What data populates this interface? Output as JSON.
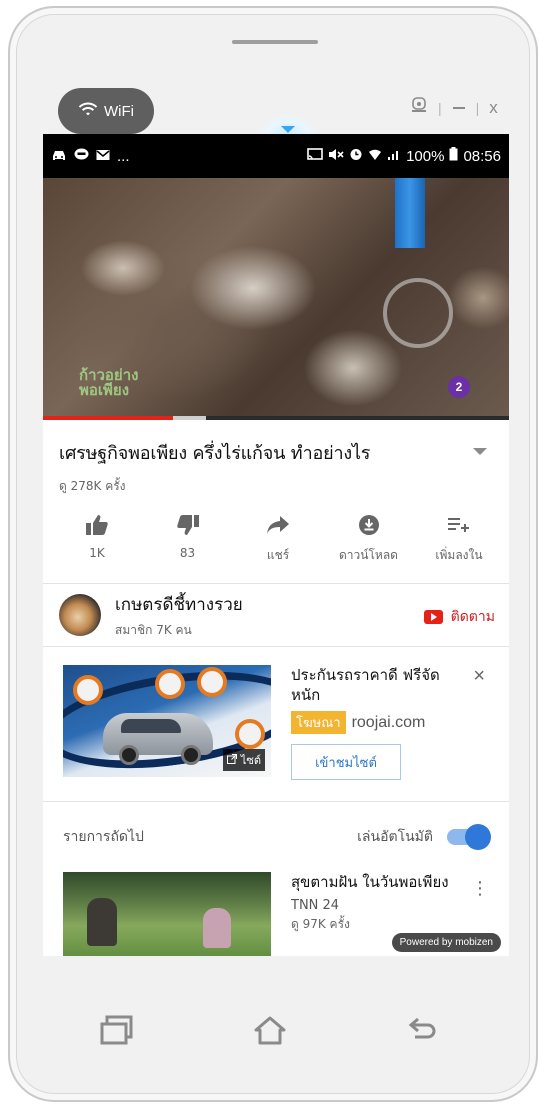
{
  "wrapper": {
    "wifi_label": "WiFi",
    "controls": {
      "separator": "|",
      "close": "x"
    }
  },
  "statusbar": {
    "left_more": "...",
    "battery": "100%",
    "time": "08:56"
  },
  "video": {
    "watermark_line1": "ก้าวอย่าง",
    "watermark_line2": "พอเพียง",
    "channel_logo": "2"
  },
  "info": {
    "title": "เศรษฐกิจพอเพียง ครึ่งไร่แก้จน ทำอย่างไร",
    "views": "ดู 278K ครั้ง"
  },
  "actions": [
    {
      "icon": "thumbs-up-icon",
      "label": "1K"
    },
    {
      "icon": "thumbs-down-icon",
      "label": "83"
    },
    {
      "icon": "share-icon",
      "label": "แชร์"
    },
    {
      "icon": "download-icon",
      "label": "ดาวน์โหลด"
    },
    {
      "icon": "add-to-playlist-icon",
      "label": "เพิ่มลงใน"
    }
  ],
  "channel": {
    "name": "เกษตรดีชี้ทางรวย",
    "subscribers": "สมาชิก 7K คน",
    "subscribe_label": "ติดตาม"
  },
  "ad": {
    "title": "ประกันรถราคาดี ฟรีจัดหนัก",
    "badge": "โฆษณา",
    "domain": "roojai.com",
    "cta": "เข้าชมไซต์",
    "thumb_site_label": "ไซต์",
    "close": "×"
  },
  "up_next": {
    "label": "รายการถัดไป",
    "autoplay_label": "เล่นอัตโนมัติ",
    "autoplay_on": true
  },
  "next_video": {
    "title": "สุขตามฝัน ในวันพอเพียง",
    "channel": "TNN 24",
    "views": "ดู 97K ครั้ง",
    "more": "⋮"
  },
  "overlay": {
    "powered_by": "Powered by mobizen"
  },
  "colors": {
    "accent_red": "#e62117",
    "ad_badge": "#f2b431",
    "link_blue": "#2b77c9",
    "toggle_blue": "#2f77d8"
  }
}
